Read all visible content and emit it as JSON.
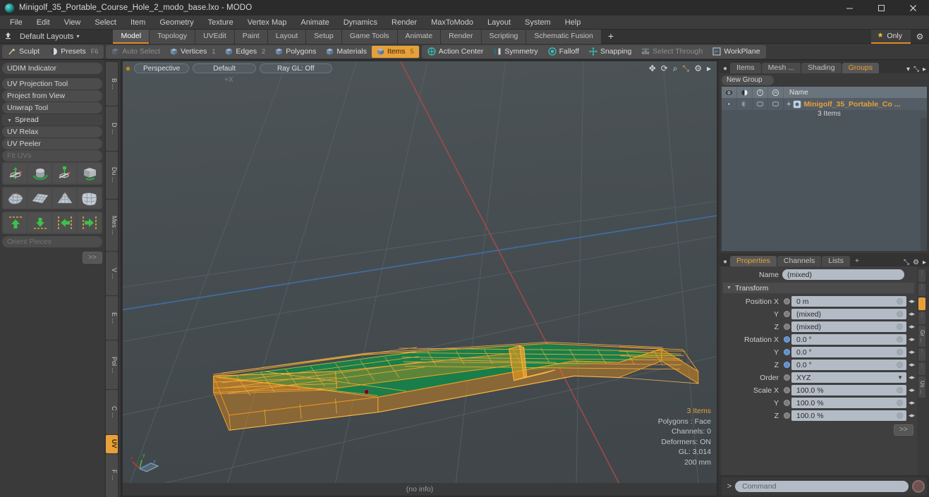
{
  "window": {
    "title": "Minigolf_35_Portable_Course_Hole_2_modo_base.lxo - MODO",
    "minimize": "—",
    "maximize": "❐",
    "close": "✕"
  },
  "menubar": {
    "items": [
      "File",
      "Edit",
      "View",
      "Select",
      "Item",
      "Geometry",
      "Texture",
      "Vertex Map",
      "Animate",
      "Dynamics",
      "Render",
      "MaxToModo",
      "Layout",
      "System",
      "Help"
    ]
  },
  "layoutbar": {
    "default_layouts": "Default Layouts",
    "caret": "▾",
    "tabs": [
      {
        "label": "Model",
        "selected": true
      },
      {
        "label": "Topology",
        "selected": false
      },
      {
        "label": "UVEdit",
        "selected": false
      },
      {
        "label": "Paint",
        "selected": false
      },
      {
        "label": "Layout",
        "selected": false
      },
      {
        "label": "Setup",
        "selected": false
      },
      {
        "label": "Game Tools",
        "selected": false
      },
      {
        "label": "Animate",
        "selected": false
      },
      {
        "label": "Render",
        "selected": false
      },
      {
        "label": "Scripting",
        "selected": false
      },
      {
        "label": "Schematic Fusion",
        "selected": false
      }
    ],
    "add_tab": "+",
    "only_label": "Only",
    "star": "★",
    "gear": "⚙"
  },
  "toolbar": {
    "group1": [
      {
        "label": "Sculpt",
        "icon": "brush-icon",
        "state": "normal",
        "num": ""
      },
      {
        "label": "Presets",
        "icon": "sphere-icon",
        "state": "normal",
        "num": "F6"
      }
    ],
    "group2": [
      {
        "label": "Auto Select",
        "icon": "cube-icon",
        "state": "dim",
        "num": ""
      },
      {
        "label": "Vertices",
        "icon": "cube-icon",
        "state": "normal",
        "num": "1"
      },
      {
        "label": "Edges",
        "icon": "cube-icon",
        "state": "normal",
        "num": "2"
      },
      {
        "label": "Polygons",
        "icon": "cube-icon",
        "state": "normal",
        "num": ""
      },
      {
        "label": "Materials",
        "icon": "cube-icon",
        "state": "normal",
        "num": ""
      },
      {
        "label": "Items",
        "icon": "cube-icon",
        "state": "active",
        "num": "5"
      }
    ],
    "group3": [
      {
        "label": "Action Center",
        "icon": "action-center-icon",
        "state": "normal",
        "num": ""
      },
      {
        "label": "Symmetry",
        "icon": "symmetry-icon",
        "state": "normal",
        "num": ""
      },
      {
        "label": "Falloff",
        "icon": "falloff-icon",
        "state": "normal",
        "num": ""
      },
      {
        "label": "Snapping",
        "icon": "snapping-icon",
        "state": "normal",
        "num": ""
      },
      {
        "label": "Select Through",
        "icon": "select-through-icon",
        "state": "dim",
        "num": ""
      },
      {
        "label": "WorkPlane",
        "icon": "workplane-icon",
        "state": "normal",
        "num": ""
      }
    ]
  },
  "left_panel": {
    "rows": [
      {
        "label": "UDIM Indicator",
        "type": "item",
        "disabled": false
      },
      {
        "label": "",
        "type": "gap",
        "disabled": false
      },
      {
        "label": "UV Projection Tool",
        "type": "item",
        "disabled": false
      },
      {
        "label": "Project from View",
        "type": "item",
        "disabled": false
      },
      {
        "label": "Unwrap Tool",
        "type": "item",
        "disabled": false
      },
      {
        "label": "Spread",
        "type": "header",
        "disabled": false
      },
      {
        "label": "UV Relax",
        "type": "item",
        "disabled": false
      },
      {
        "label": "UV Peeler",
        "type": "item",
        "disabled": false
      },
      {
        "label": "Fit UVs",
        "type": "item",
        "disabled": true
      }
    ],
    "icon_grids": [
      [
        "uv-projection-gizmo-icon",
        "uv-rotate-cube-icon",
        "uv-move-gizmo-icon",
        "uv-unwrap-box-icon"
      ],
      [
        "uv-relax-mesh-icon",
        "uv-flat-grid-icon",
        "uv-taper-grid-icon",
        "uv-peel-grid-icon"
      ],
      [
        "uv-align-up-icon",
        "uv-align-down-icon",
        "uv-align-left-icon",
        "uv-align-right-icon"
      ]
    ],
    "orient_pieces": "Orient Pieces",
    "more": ">>",
    "vtabs": [
      {
        "label": "B ...",
        "selected": false
      },
      {
        "label": "D ...",
        "selected": false
      },
      {
        "label": "Du ...",
        "selected": false
      },
      {
        "label": "Mes ...",
        "selected": false
      },
      {
        "label": "V ...",
        "selected": false
      },
      {
        "label": "E ...",
        "selected": false
      },
      {
        "label": "Pol ...",
        "selected": false
      },
      {
        "label": "C ...",
        "selected": false
      },
      {
        "label": "UV",
        "selected": true
      },
      {
        "label": "F ...",
        "selected": false
      }
    ]
  },
  "viewport": {
    "buttons": [
      {
        "label": "Perspective",
        "name": "view-mode-button"
      },
      {
        "label": "Default",
        "name": "shading-style-button"
      },
      {
        "label": "Ray GL: Off",
        "name": "raygl-button"
      }
    ],
    "icons": [
      {
        "name": "pan-icon",
        "glyph": "✥",
        "highlight": false
      },
      {
        "name": "rotate-icon",
        "glyph": "⟳",
        "highlight": false
      },
      {
        "name": "zoom-icon",
        "glyph": "⌕",
        "highlight": false
      },
      {
        "name": "fit-icon",
        "glyph": "⤡",
        "highlight": true
      },
      {
        "name": "viewport-settings-icon",
        "glyph": "⚙",
        "highlight": false
      },
      {
        "name": "viewport-menu-icon",
        "glyph": "▸",
        "highlight": false
      }
    ],
    "axis_label": "+X",
    "info": {
      "items": "3 Items",
      "polygons": "Polygons : Face",
      "channels": "Channels: 0",
      "deformers": "Deformers: ON",
      "gl": "GL: 3,014",
      "scale": "200 mm"
    },
    "gizmo": {
      "x": "x",
      "y": "y",
      "z": "z"
    },
    "status": "(no info)"
  },
  "right_panel": {
    "top_tabs": {
      "tabs": [
        {
          "label": "Items",
          "selected": false
        },
        {
          "label": "Mesh ...",
          "selected": false
        },
        {
          "label": "Shading",
          "selected": false
        },
        {
          "label": "Groups",
          "selected": true
        }
      ],
      "caret": "▾",
      "expand": "⤡",
      "menu": "▸"
    },
    "new_group": "New Group",
    "tree": {
      "col_icons": [
        "visibility-eye-icon",
        "render-eye-icon",
        "lock-icon",
        "ghost-icon"
      ],
      "name_header": "Name",
      "rows": [
        {
          "name": "Minigolf_35_Portable_Co ...",
          "sub": "3 Items",
          "expander": "+",
          "icon": "group-item-icon"
        }
      ]
    },
    "properties": {
      "tabs": [
        {
          "label": "Properties",
          "selected": true
        },
        {
          "label": "Channels",
          "selected": false
        },
        {
          "label": "Lists",
          "selected": false
        }
      ],
      "add": "+",
      "expand": "⤡",
      "gear": "⚙",
      "menu": "▸",
      "name_label": "Name",
      "name_value": "(mixed)",
      "transform_label": "Transform",
      "fields": [
        {
          "label": "Position X",
          "value": "0 m",
          "bullet": "grey",
          "type": "num"
        },
        {
          "label": "Y",
          "value": "(mixed)",
          "bullet": "grey",
          "type": "num"
        },
        {
          "label": "Z",
          "value": "(mixed)",
          "bullet": "grey",
          "type": "num"
        },
        {
          "label": "Rotation X",
          "value": "0.0 °",
          "bullet": "blue",
          "type": "num"
        },
        {
          "label": "Y",
          "value": "0.0 °",
          "bullet": "blue",
          "type": "num"
        },
        {
          "label": "Z",
          "value": "0.0 °",
          "bullet": "blue",
          "type": "num"
        },
        {
          "label": "Order",
          "value": "XYZ",
          "bullet": "grey",
          "type": "dropdown"
        },
        {
          "label": "Scale X",
          "value": "100.0 %",
          "bullet": "grey",
          "type": "num"
        },
        {
          "label": "Y",
          "value": "100.0 %",
          "bullet": "grey",
          "type": "num"
        },
        {
          "label": "Z",
          "value": "100.0 %",
          "bullet": "grey",
          "type": "num"
        }
      ],
      "more": ">>",
      "side_tabs": [
        "Gr ...",
        "Us ..."
      ]
    }
  },
  "command_bar": {
    "prompt": ">",
    "placeholder": "Command",
    "record": "record-button"
  },
  "colors": {
    "accent": "#e8a03a",
    "selection_orange": "#f5a01e",
    "mesh_green": "#1f8a4d",
    "panel_bg": "#3a3a3a",
    "viewport_bg": "#474e52"
  }
}
